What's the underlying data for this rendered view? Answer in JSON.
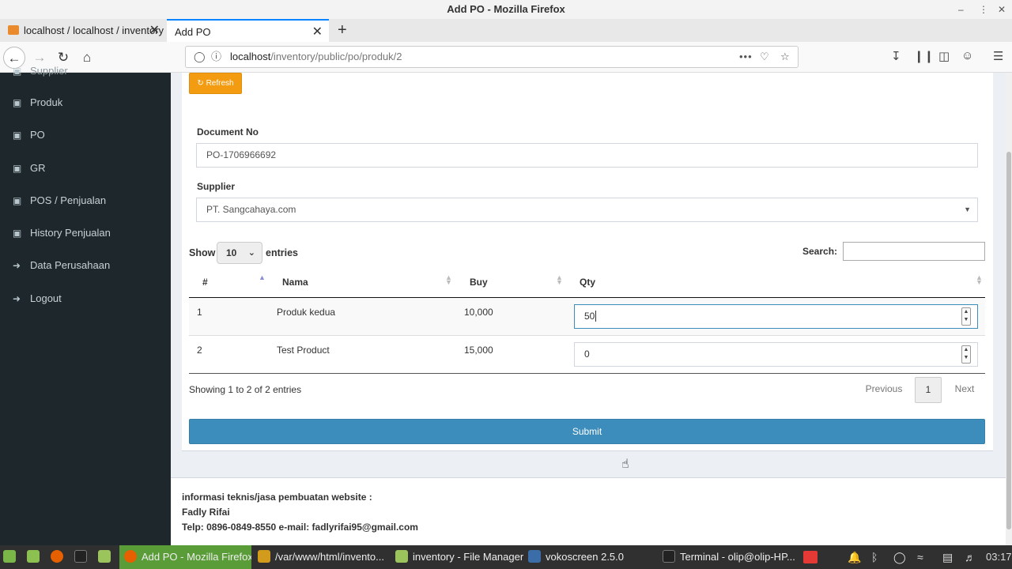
{
  "window": {
    "title": "Add PO - Mozilla Firefox"
  },
  "tabs": [
    {
      "label": "localhost / localhost / inventory"
    },
    {
      "label": "Add PO"
    }
  ],
  "urlbar": {
    "host": "localhost",
    "path": "/inventory/public/po/produk/2"
  },
  "sidebar": {
    "items": [
      {
        "label": "Supplier"
      },
      {
        "label": "Produk"
      },
      {
        "label": "PO"
      },
      {
        "label": "GR"
      },
      {
        "label": "POS / Penjualan"
      },
      {
        "label": "History Penjualan"
      },
      {
        "label": "Data Perusahaan"
      },
      {
        "label": "Logout"
      }
    ]
  },
  "form": {
    "refresh_label": "Refresh",
    "document_no_label": "Document No",
    "document_no_value": "PO-1706966692",
    "supplier_label": "Supplier",
    "supplier_value": "PT. Sangcahaya.com"
  },
  "table_controls": {
    "show_label": "Show",
    "entries_label": "entries",
    "page_length": "10",
    "search_label": "Search:",
    "search_value": ""
  },
  "table": {
    "headers": [
      "#",
      "Nama",
      "Buy",
      "Qty"
    ],
    "rows": [
      {
        "no": "1",
        "nama": "Produk kedua",
        "buy": "10,000",
        "qty": "50"
      },
      {
        "no": "2",
        "nama": "Test Product",
        "buy": "15,000",
        "qty": "0"
      }
    ]
  },
  "pagination": {
    "info": "Showing 1 to 2 of 2 entries",
    "previous": "Previous",
    "current": "1",
    "next": "Next"
  },
  "submit_label": "Submit",
  "footer": {
    "line1": "informasi teknis/jasa pembuatan website :",
    "line2": "Fadly Rifai",
    "line3": "Telp: 0896-0849-8550 e-mail: fadlyrifai95@gmail.com"
  },
  "taskbar": {
    "items": [
      {
        "label": "Add PO - Mozilla Firefox"
      },
      {
        "label": "/var/www/html/invento..."
      },
      {
        "label": "inventory - File Manager"
      },
      {
        "label": "vokoscreen 2.5.0"
      },
      {
        "label": "Terminal - olip@olip-HP..."
      }
    ],
    "clock": "03:17"
  },
  "colors": {
    "sidebar_bg": "#1e282c",
    "refresh_button": "#f39c12",
    "submit_button": "#3c8dbc",
    "taskbar_active": "#5a9c38"
  }
}
